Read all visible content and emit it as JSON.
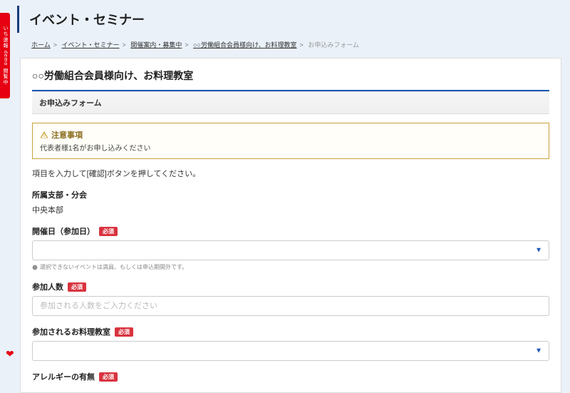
{
  "side_tab": "いち速報 demo 閲覧中",
  "page_title": "イベント・セミナー",
  "breadcrumb": {
    "items": [
      {
        "label": "ホーム",
        "link": true
      },
      {
        "label": "イベント・セミナー",
        "link": true
      },
      {
        "label": "開催案内・募集中",
        "link": true
      },
      {
        "label": "○○労働組合会員様向け、お料理教室",
        "link": true
      },
      {
        "label": "お申込みフォーム",
        "link": false
      }
    ]
  },
  "card": {
    "title": "○○労働組合会員様向け、お料理教室",
    "section": "お申込みフォーム",
    "notice_title": "注意事項",
    "notice_body": "代表者様1名がお申し込みください",
    "lead": "項目を入力して[確認]ボタンを押してください。",
    "fields": {
      "branch": {
        "label": "所属支部・分会",
        "value": "中央本部"
      },
      "date": {
        "label": "開催日（参加日）",
        "required": "必須",
        "hint": "選択できないイベントは満員、もしくは申込期間外です。"
      },
      "count": {
        "label": "参加人数",
        "required": "必須",
        "placeholder": "参加される人数をご入力ください"
      },
      "class": {
        "label": "参加されるお料理教室",
        "required": "必須"
      },
      "allergy": {
        "label": "アレルギーの有無",
        "required": "必須"
      }
    }
  }
}
